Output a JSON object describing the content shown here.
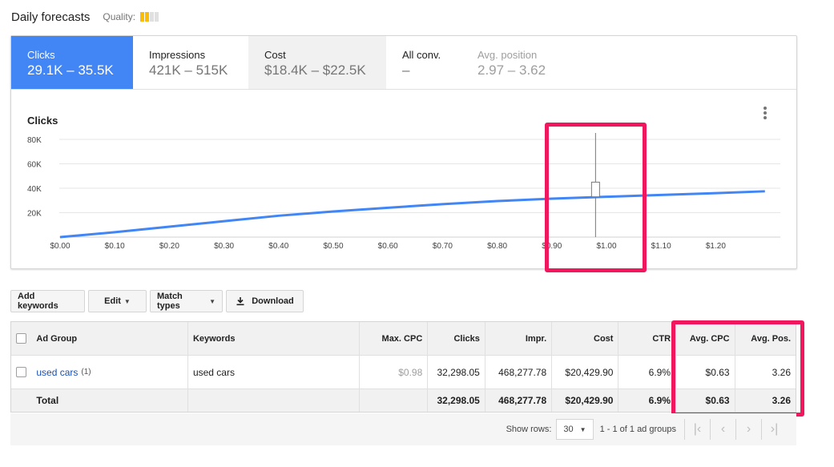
{
  "header": {
    "title": "Daily forecasts",
    "quality_label": "Quality:"
  },
  "quality": {
    "level": 2,
    "max": 4,
    "color": "#fbbc04"
  },
  "metric_tabs": [
    {
      "label": "Clicks",
      "value": "29.1K – 35.5K"
    },
    {
      "label": "Impressions",
      "value": "421K – 515K"
    },
    {
      "label": "Cost",
      "value": "$18.4K – $22.5K"
    },
    {
      "label": "All conv.",
      "value": "–"
    },
    {
      "label": "Avg. position",
      "value": "2.97 – 3.62"
    }
  ],
  "chart_title": "Clicks",
  "chart_data": {
    "type": "line",
    "ylim": [
      0,
      80000
    ],
    "yticks": [
      "80K",
      "60K",
      "40K",
      "20K"
    ],
    "yticks_values": [
      80000,
      60000,
      40000,
      20000
    ],
    "xlim": [
      0,
      1.3
    ],
    "xticks": [
      "$0.00",
      "$0.10",
      "$0.20",
      "$0.30",
      "$0.40",
      "$0.50",
      "$0.60",
      "$0.70",
      "$0.80",
      "$0.90",
      "$1.00",
      "$1.10",
      "$1.20"
    ],
    "xticks_values": [
      0,
      0.1,
      0.2,
      0.3,
      0.4,
      0.5,
      0.6,
      0.7,
      0.8,
      0.9,
      1.0,
      1.1,
      1.2
    ],
    "series": [
      {
        "x": [
          0,
          0.1,
          0.2,
          0.3,
          0.4,
          0.5,
          0.6,
          0.7,
          0.8,
          0.9,
          1.0,
          1.1,
          1.2,
          1.29
        ],
        "y": [
          0,
          4000,
          8500,
          13000,
          17500,
          21000,
          24000,
          27000,
          29500,
          31500,
          33000,
          34500,
          36000,
          37500
        ]
      }
    ],
    "range_marker": {
      "x": 0.98,
      "y_low": 0,
      "y_high": 80000,
      "box_low": 33000,
      "box_high": 45000
    },
    "grid": true,
    "line_color": "#4285f4"
  },
  "toolbar": {
    "add_keywords": "Add keywords",
    "edit": "Edit",
    "match_types": "Match types",
    "download": "Download"
  },
  "table": {
    "headers": [
      "Ad Group",
      "Keywords",
      "Max. CPC",
      "Clicks",
      "Impr.",
      "Cost",
      "CTR",
      "Avg. CPC",
      "Avg. Pos."
    ],
    "rows": [
      {
        "ad_group": "used cars",
        "ad_group_count": "(1)",
        "keywords": "used cars",
        "max_cpc": "$0.98",
        "clicks": "32,298.05",
        "impr": "468,277.78",
        "cost": "$20,429.90",
        "ctr": "6.9%",
        "avg_cpc": "$0.63",
        "avg_pos": "3.26"
      }
    ],
    "total": {
      "label": "Total",
      "clicks": "32,298.05",
      "impr": "468,277.78",
      "cost": "$20,429.90",
      "ctr": "6.9%",
      "avg_cpc": "$0.63",
      "avg_pos": "3.26"
    }
  },
  "pager": {
    "show_rows_label": "Show rows:",
    "rows": "30",
    "range": "1 - 1 of 1 ad groups"
  },
  "highlight_color": "#f0175f"
}
